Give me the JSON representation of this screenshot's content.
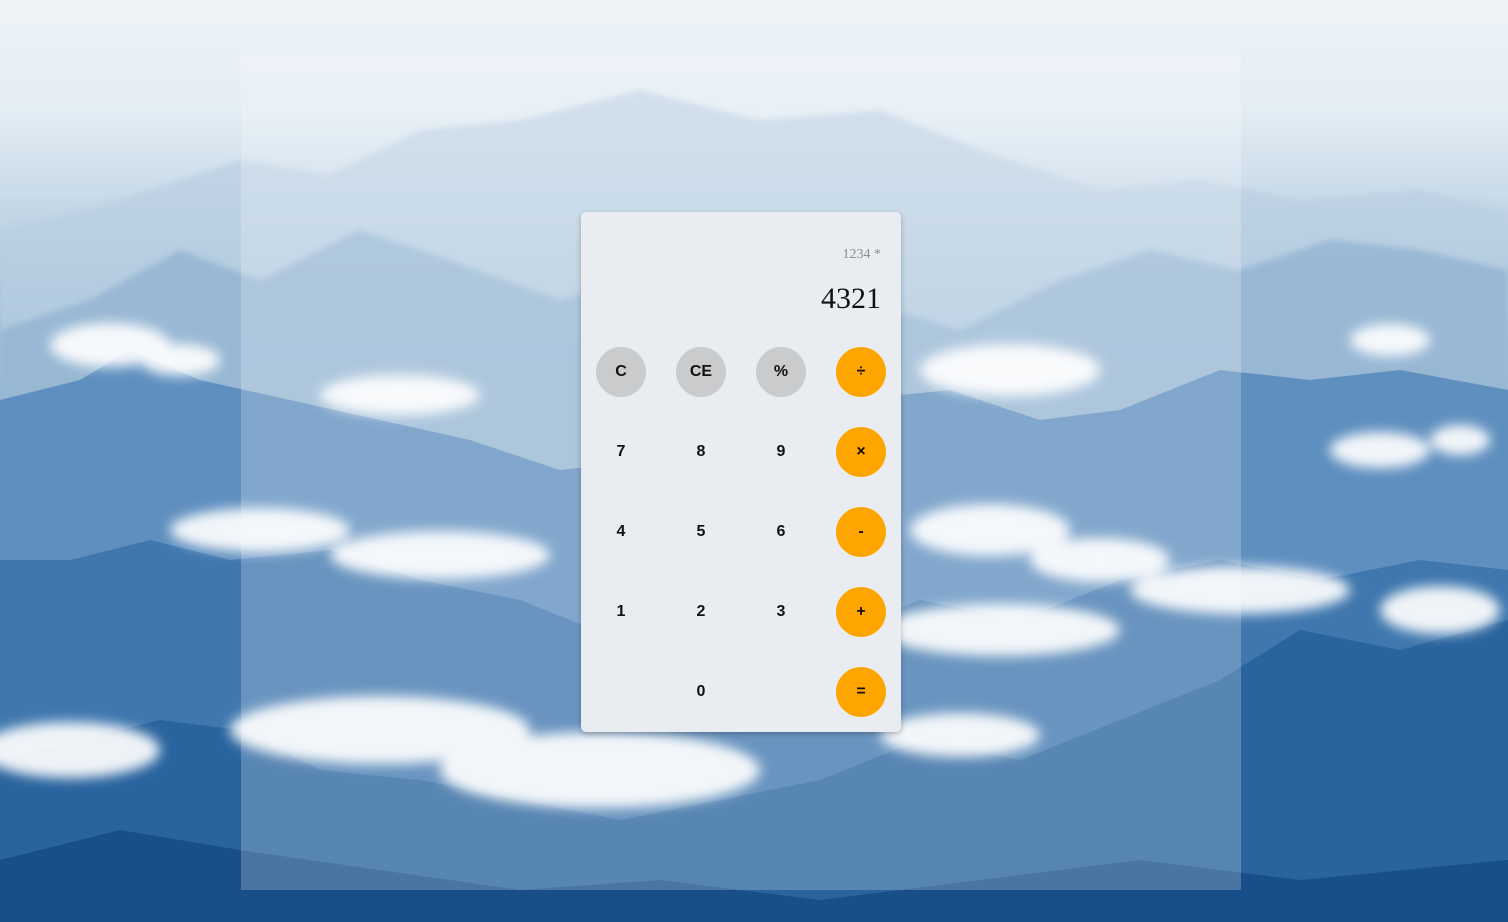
{
  "display": {
    "expression": "1234 *",
    "result": "4321"
  },
  "keys": {
    "clear": "C",
    "clear_entry": "CE",
    "percent": "%",
    "divide": "÷",
    "seven": "7",
    "eight": "8",
    "nine": "9",
    "multiply": "×",
    "four": "4",
    "five": "5",
    "six": "6",
    "subtract": "-",
    "one": "1",
    "two": "2",
    "three": "3",
    "add": "+",
    "zero": "0",
    "equals": "="
  },
  "colors": {
    "operator": "#ffa500",
    "function": "#c9cbcd",
    "calculator_body": "#e9edf1"
  }
}
